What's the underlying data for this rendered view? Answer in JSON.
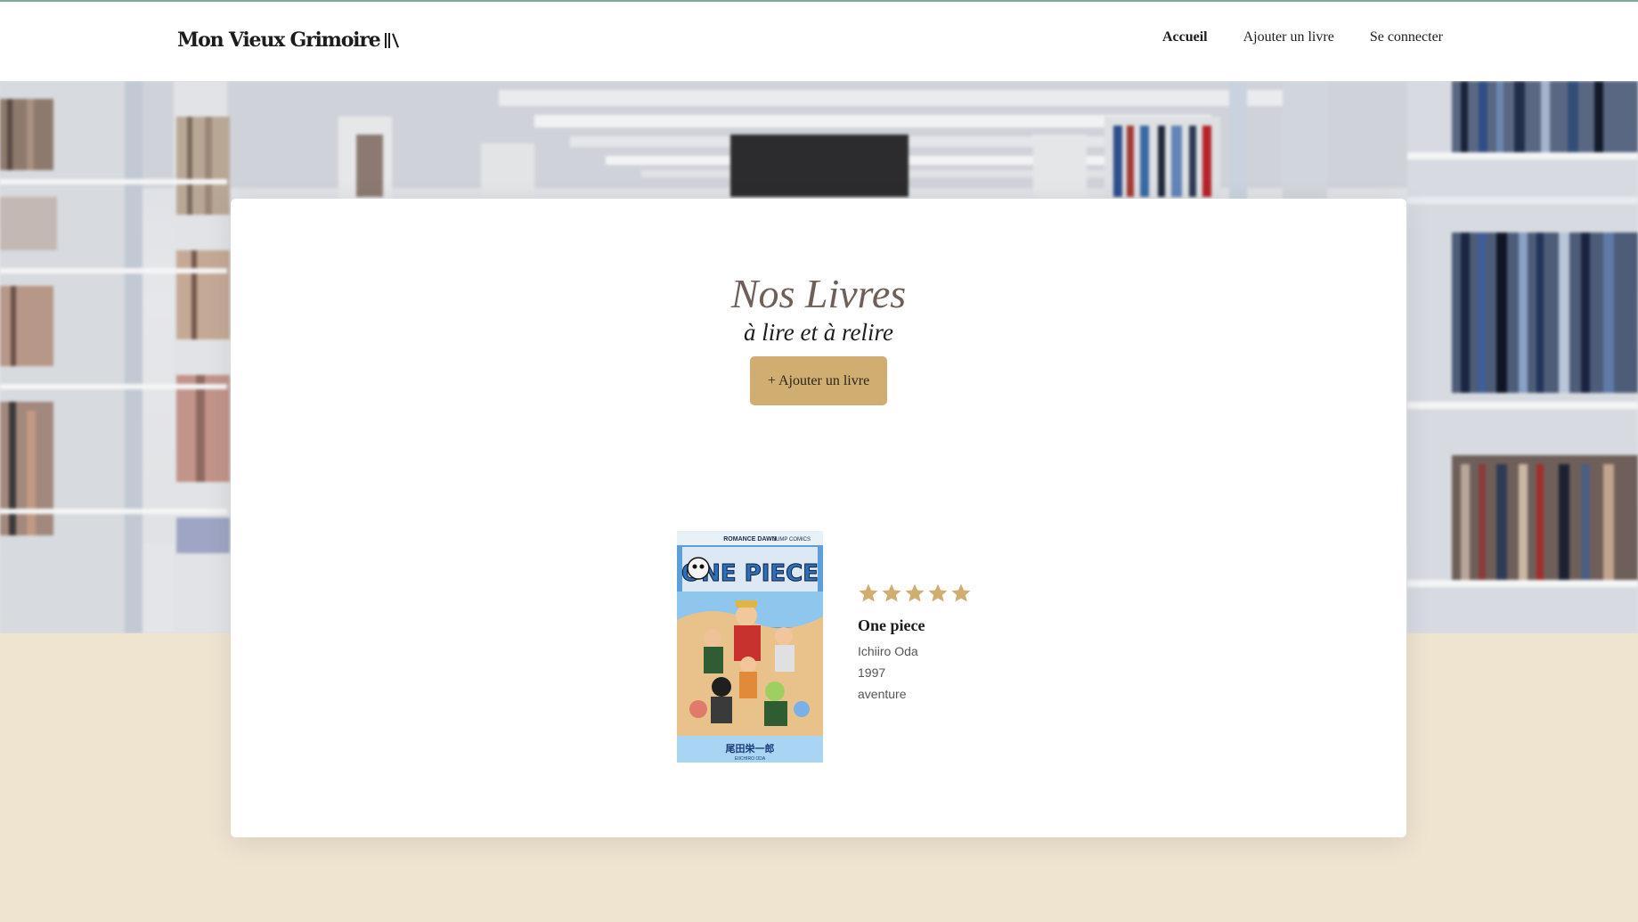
{
  "header": {
    "logo_text": "Mon Vieux Grimoire",
    "logo_icon": "books-icon",
    "nav": [
      {
        "label": "Accueil",
        "active": true
      },
      {
        "label": "Ajouter un livre",
        "active": false
      },
      {
        "label": "Se connecter",
        "active": false
      }
    ]
  },
  "main": {
    "title": "Nos Livres",
    "subtitle": "à lire et à relire",
    "add_button_label": "+ Ajouter un livre"
  },
  "books": [
    {
      "title": "One piece",
      "author": "Ichiiro Oda",
      "year": "1997",
      "genre": "aventure",
      "rating": 5,
      "rating_max": 5,
      "cover": {
        "series_title": "ONE PIECE",
        "top_text": "ROMANCE DAWN",
        "publisher_text": "JUMP COMICS",
        "author_jp": "尾田栄一郎",
        "author_romaji": "EIICHIRO ODA"
      }
    }
  ],
  "colors": {
    "accent": "#d0ad70",
    "page_bg": "#efe4d0",
    "title": "#6e5f58",
    "star": "#d0ad70"
  }
}
